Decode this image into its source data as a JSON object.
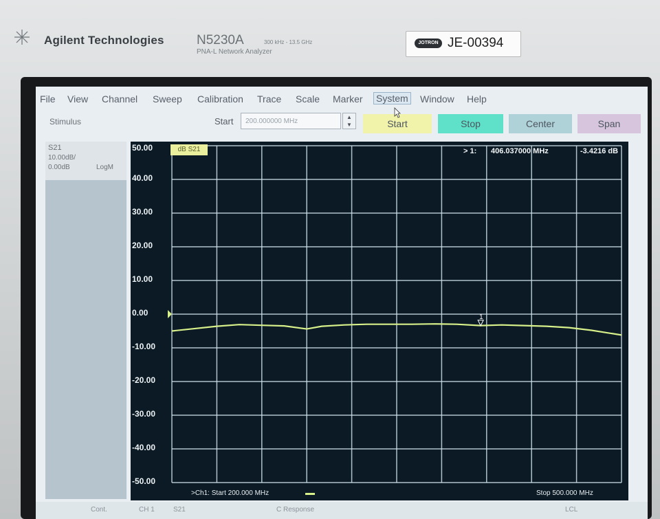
{
  "header": {
    "brand": "Agilent Technologies",
    "model": "N5230A",
    "model_range": "300 kHz - 13.5 GHz",
    "model_sub": "PNA-L Network Analyzer",
    "asset_logo": "JOTRON",
    "asset_id": "JE-00394"
  },
  "menu": [
    "File",
    "View",
    "Channel",
    "Sweep",
    "Calibration",
    "Trace",
    "Scale",
    "Marker",
    "System",
    "Window",
    "Help"
  ],
  "menu_active": "System",
  "toolbar": {
    "stimulus_label": "Stimulus",
    "start_label": "Start",
    "start_value": "200.000000 MHz",
    "buttons": [
      "Start",
      "Stop",
      "Center",
      "Span"
    ]
  },
  "trace_status": {
    "name": "S21",
    "scale": "10.00dB/",
    "ref": "0.00dB",
    "format": "LogM"
  },
  "plot": {
    "trace_tag": "dB S21",
    "marker_id": "> 1:",
    "marker_freq": "406.037000 MHz",
    "marker_value": "-3.4216 dB",
    "marker_label": "1",
    "footer_left": ">Ch1: Start  200.000 MHz",
    "footer_right": "Stop  500.000 MHz",
    "y_ticks": [
      "50.00",
      "40.00",
      "30.00",
      "20.00",
      "10.00",
      "0.00",
      "-10.00",
      "-20.00",
      "-30.00",
      "-40.00",
      "-50.00"
    ],
    "y_min": -50,
    "y_max": 50,
    "x_min_mhz": 200,
    "x_max_mhz": 500,
    "marker_x_mhz": 406.037,
    "marker_y_db": -3.4216,
    "trace_color": "#d8f08a",
    "trace_points_mhz": [
      200,
      215,
      230,
      245,
      260,
      275,
      290,
      300,
      315,
      330,
      345,
      360,
      375,
      390,
      406,
      420,
      435,
      450,
      465,
      480,
      500
    ],
    "trace_points_db": [
      -5.0,
      -4.3,
      -3.6,
      -3.1,
      -3.3,
      -3.5,
      -4.4,
      -3.6,
      -3.2,
      -3.0,
      -3.0,
      -3.0,
      -2.9,
      -3.0,
      -3.4,
      -3.2,
      -3.4,
      -3.6,
      -4.0,
      -4.8,
      -6.2
    ]
  },
  "statusbar": {
    "items": [
      "Cont.",
      "CH 1",
      "S21",
      "C  Response",
      "LCL"
    ]
  },
  "colors": {
    "plot_bg": "#0b1a24",
    "grid": "#cfe0ea",
    "stop_button": "#5fe0c9",
    "start_button": "#f0f3a9"
  }
}
